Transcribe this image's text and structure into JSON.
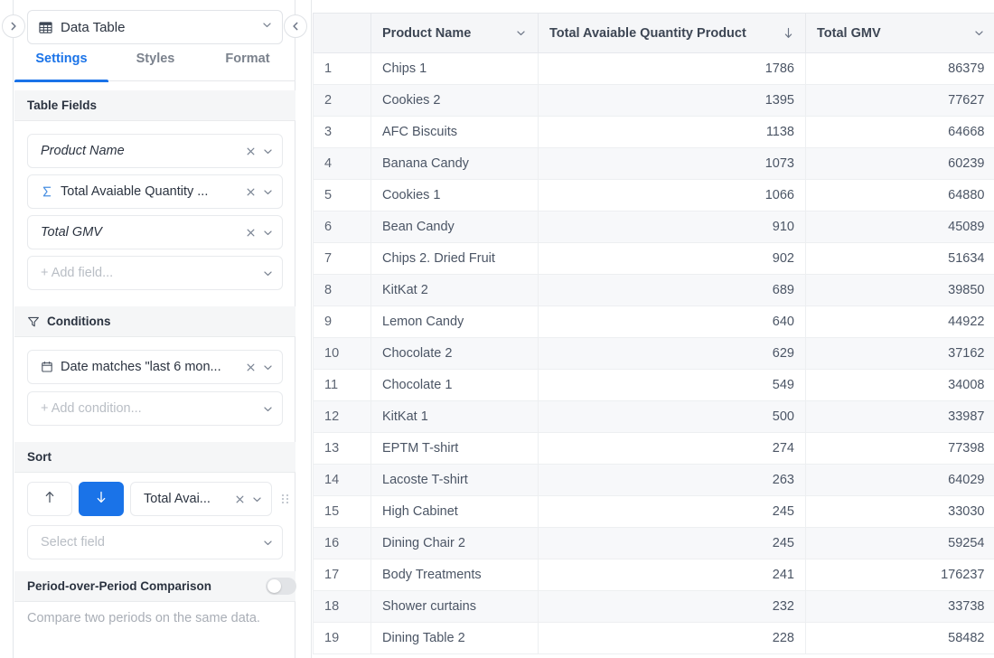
{
  "panel": {
    "collapse_left_icon": "chevron-right-icon",
    "collapse_right_icon": "chevron-left-icon",
    "selector": {
      "icon": "table-grid-icon",
      "label": "Data Table",
      "chevron": "chevron-down-icon"
    },
    "tabs": [
      {
        "label": "Settings",
        "active": true
      },
      {
        "label": "Styles",
        "active": false
      },
      {
        "label": "Format",
        "active": false
      }
    ],
    "sections": {
      "table_fields": {
        "title": "Table Fields",
        "icon": null,
        "fields": [
          {
            "label": "Product Name",
            "italic": true,
            "icon": null,
            "removable": true
          },
          {
            "label": "Total Avaiable Quantity ...",
            "italic": false,
            "icon": "sigma-icon",
            "removable": true
          },
          {
            "label": "Total GMV",
            "italic": true,
            "icon": null,
            "removable": true
          }
        ],
        "add_placeholder": "+ Add field..."
      },
      "conditions": {
        "title": "Conditions",
        "icon": "filter-icon",
        "items": [
          {
            "label": "Date matches \"last 6 mon...",
            "icon": "calendar-icon",
            "removable": true
          }
        ],
        "add_placeholder": "+ Add condition..."
      },
      "sort": {
        "title": "Sort",
        "asc_icon": "arrow-up-icon",
        "desc_icon": "arrow-down-icon",
        "active_direction": "desc",
        "field_label": "Total Avai...",
        "drag_icon": "drag-handle-icon",
        "select_placeholder": "Select field"
      },
      "period_comparison": {
        "title": "Period-over-Period Comparison",
        "toggle_on": false,
        "hint": "Compare two periods on the same data."
      }
    }
  },
  "colors": {
    "accent": "#1a73e8",
    "sigma": "#4a90e2",
    "header_bg": "#f5f6f8",
    "row_alt_bg": "#f7f8fa",
    "text": "#2b3340",
    "muted": "#b9bec5"
  },
  "table": {
    "columns": [
      {
        "key": "idx",
        "label": "",
        "icon": null,
        "align": "left"
      },
      {
        "key": "name",
        "label": "Product Name",
        "icon": "chevron-down-icon",
        "align": "left"
      },
      {
        "key": "qty",
        "label": "Total Avaiable Quantity Product",
        "icon": "arrow-down-icon",
        "align": "left"
      },
      {
        "key": "gmv",
        "label": "Total GMV",
        "icon": "chevron-down-icon",
        "align": "left"
      }
    ],
    "rows": [
      {
        "idx": "1",
        "name": "Chips 1",
        "qty": "1786",
        "gmv": "86379"
      },
      {
        "idx": "2",
        "name": "Cookies 2",
        "qty": "1395",
        "gmv": "77627"
      },
      {
        "idx": "3",
        "name": "AFC Biscuits",
        "qty": "1138",
        "gmv": "64668"
      },
      {
        "idx": "4",
        "name": "Banana Candy",
        "qty": "1073",
        "gmv": "60239"
      },
      {
        "idx": "5",
        "name": "Cookies 1",
        "qty": "1066",
        "gmv": "64880"
      },
      {
        "idx": "6",
        "name": "Bean Candy",
        "qty": "910",
        "gmv": "45089"
      },
      {
        "idx": "7",
        "name": "Chips 2. Dried Fruit",
        "qty": "902",
        "gmv": "51634"
      },
      {
        "idx": "8",
        "name": "KitKat 2",
        "qty": "689",
        "gmv": "39850"
      },
      {
        "idx": "9",
        "name": "Lemon Candy",
        "qty": "640",
        "gmv": "44922"
      },
      {
        "idx": "10",
        "name": "Chocolate 2",
        "qty": "629",
        "gmv": "37162"
      },
      {
        "idx": "11",
        "name": "Chocolate 1",
        "qty": "549",
        "gmv": "34008"
      },
      {
        "idx": "12",
        "name": "KitKat 1",
        "qty": "500",
        "gmv": "33987"
      },
      {
        "idx": "13",
        "name": "EPTM T-shirt",
        "qty": "274",
        "gmv": "77398"
      },
      {
        "idx": "14",
        "name": "Lacoste T-shirt",
        "qty": "263",
        "gmv": "64029"
      },
      {
        "idx": "15",
        "name": "High Cabinet",
        "qty": "245",
        "gmv": "33030"
      },
      {
        "idx": "16",
        "name": "Dining Chair 2",
        "qty": "245",
        "gmv": "59254"
      },
      {
        "idx": "17",
        "name": "Body Treatments",
        "qty": "241",
        "gmv": "176237"
      },
      {
        "idx": "18",
        "name": "Shower curtains",
        "qty": "232",
        "gmv": "33738"
      },
      {
        "idx": "19",
        "name": "Dining Table 2",
        "qty": "228",
        "gmv": "58482"
      }
    ]
  }
}
